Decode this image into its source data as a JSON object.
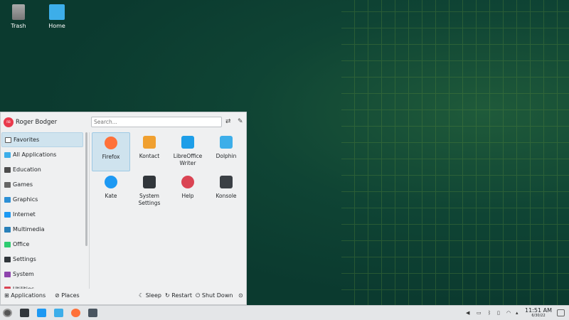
{
  "desktop": {
    "icons": [
      {
        "label": "Trash",
        "icon": "trash-icon"
      },
      {
        "label": "Home",
        "icon": "home-folder-icon"
      }
    ]
  },
  "menu": {
    "user": {
      "initials": "RB",
      "name": "Roger Bodger"
    },
    "search": {
      "placeholder": "Search..."
    },
    "categories": [
      {
        "label": "Favorites",
        "icon": "bookmark-icon",
        "color": "#ffffff",
        "selected": true
      },
      {
        "label": "All Applications",
        "icon": "grid-icon",
        "color": "#3daee9"
      },
      {
        "label": "Education",
        "icon": "education-icon",
        "color": "#4d4d4d"
      },
      {
        "label": "Games",
        "icon": "gamepad-icon",
        "color": "#666666"
      },
      {
        "label": "Graphics",
        "icon": "graphics-icon",
        "color": "#2d8fd5"
      },
      {
        "label": "Internet",
        "icon": "globe-icon",
        "color": "#1d99f3"
      },
      {
        "label": "Multimedia",
        "icon": "multimedia-icon",
        "color": "#2980b9"
      },
      {
        "label": "Office",
        "icon": "office-icon",
        "color": "#2ecc71"
      },
      {
        "label": "Settings",
        "icon": "settings-icon",
        "color": "#31363b"
      },
      {
        "label": "System",
        "icon": "system-icon",
        "color": "#8e44ad"
      },
      {
        "label": "Utilities",
        "icon": "utilities-icon",
        "color": "#da4453"
      }
    ],
    "favorites": [
      {
        "label": "Firefox",
        "icon": "firefox-icon",
        "color": "#ff7139",
        "selected": true
      },
      {
        "label": "Kontact",
        "icon": "kontact-icon",
        "color": "#f0a030"
      },
      {
        "label": "LibreOffice Writer",
        "icon": "writer-icon",
        "color": "#1e9ee8"
      },
      {
        "label": "Dolphin",
        "icon": "dolphin-icon",
        "color": "#3daee9"
      },
      {
        "label": "Kate",
        "icon": "kate-icon",
        "color": "#1d99f3"
      },
      {
        "label": "System Settings",
        "icon": "system-settings-icon",
        "color": "#31363b"
      },
      {
        "label": "Help",
        "icon": "help-lifebuoy-icon",
        "color": "#da4453"
      },
      {
        "label": "Konsole",
        "icon": "konsole-icon",
        "color": "#3b4045"
      }
    ],
    "footer": {
      "applications": "Applications",
      "places": "Places",
      "sleep": "Sleep",
      "restart": "Restart",
      "shutdown": "Shut Down"
    }
  },
  "taskbar": {
    "time": "11:51 AM",
    "date": "6/30/22"
  }
}
